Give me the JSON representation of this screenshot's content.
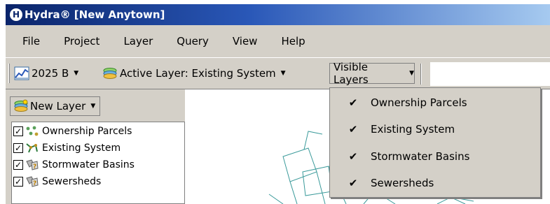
{
  "window": {
    "logo": "H",
    "title": "Hydra® [New Anytown]"
  },
  "menu": [
    "File",
    "Project",
    "Layer",
    "Query",
    "View",
    "Help"
  ],
  "toolbar": {
    "scenario_label": "2025 B",
    "active_layer_label": "Active Layer: Existing System",
    "visible_layers_label": "Visible Layers",
    "dropdown_arrow": "▼"
  },
  "left_panel": {
    "new_layer_label": "New Layer",
    "layers": [
      {
        "label": "Ownership Parcels",
        "checked": true,
        "icon": "parcels-icon"
      },
      {
        "label": "Existing System",
        "checked": true,
        "icon": "network-icon"
      },
      {
        "label": "Stormwater Basins",
        "checked": true,
        "icon": "basin-icon"
      },
      {
        "label": "Sewersheds",
        "checked": true,
        "icon": "sewershed-icon"
      }
    ],
    "check_mark": "✓"
  },
  "visible_layers_menu": {
    "check_mark": "✔",
    "items": [
      {
        "label": "Ownership Parcels",
        "checked": true
      },
      {
        "label": "Existing System",
        "checked": true
      },
      {
        "label": "Stormwater Basins",
        "checked": true
      },
      {
        "label": "Sewersheds",
        "checked": true
      }
    ]
  },
  "colors": {
    "titlebar_start": "#0a246a",
    "titlebar_end": "#a6caf0",
    "chrome": "#d4d0c8",
    "map_lines": "#3a9a9a"
  }
}
